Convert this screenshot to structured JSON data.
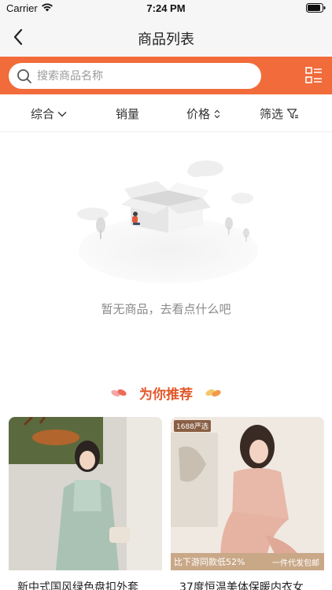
{
  "status_bar": {
    "carrier": "Carrier",
    "time": "7:24 PM"
  },
  "nav": {
    "title": "商品列表"
  },
  "search": {
    "placeholder": "搜索商品名称"
  },
  "filters": {
    "comprehensive": "综合",
    "sales": "销量",
    "price": "价格",
    "filter": "筛选"
  },
  "empty_state": {
    "message": "暂无商品，去看点什么吧"
  },
  "recommend": {
    "title": "为你推荐"
  },
  "products": [
    {
      "name": "新中式国风绿色盘扣外套"
    },
    {
      "name": "37度恒温美体保暖内衣女",
      "badge": "1688严选",
      "promo_left": "比下游同款低52%",
      "promo_right": "一件代发包邮"
    }
  ],
  "colors": {
    "accent": "#f26b3a",
    "recommend_title": "#e2582a"
  }
}
